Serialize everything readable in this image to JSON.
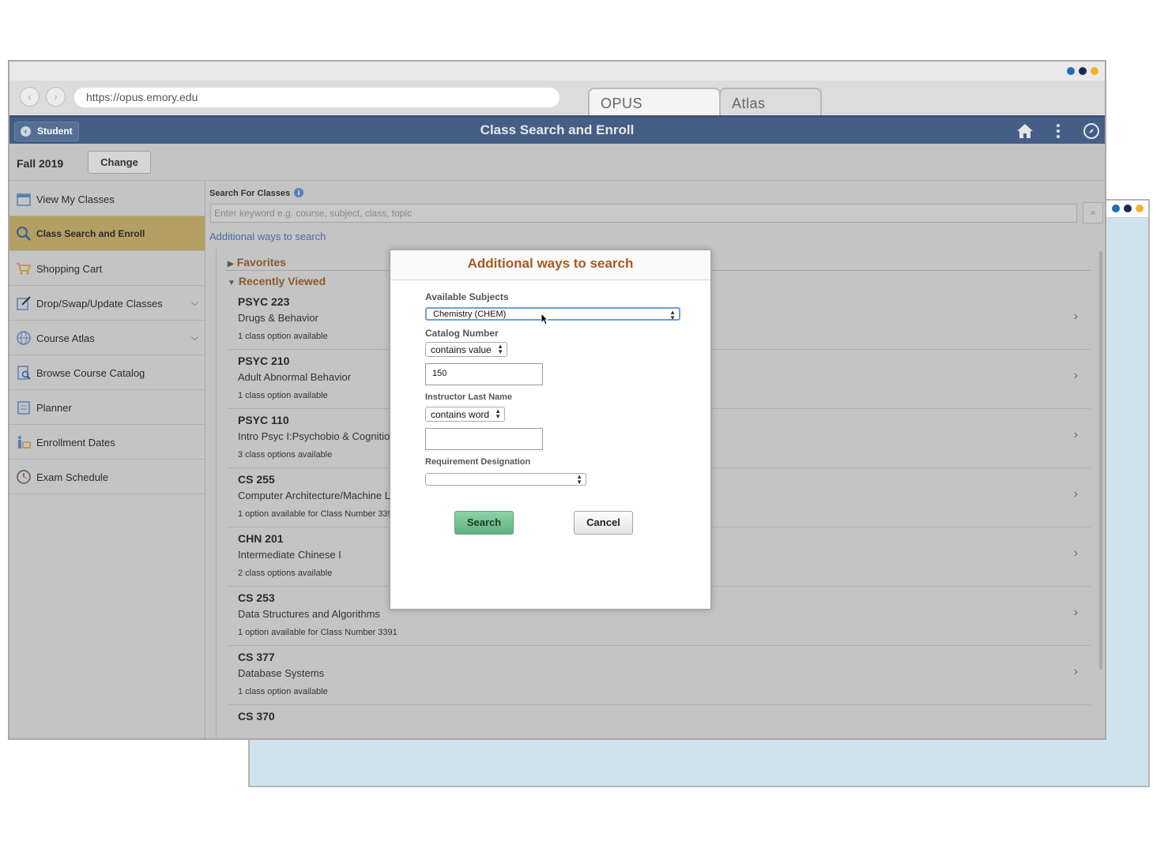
{
  "browser": {
    "url": "https://opus.emory.edu",
    "tabs": [
      "OPUS",
      "Atlas"
    ],
    "window_dot_colors": [
      "#1f6fb5",
      "#1c2a52",
      "#f2b324"
    ]
  },
  "header": {
    "back_label": "Student",
    "title": "Class Search and Enroll"
  },
  "term": {
    "label": "Fall 2019",
    "change_label": "Change"
  },
  "sidebar": {
    "items": [
      {
        "label": "View My Classes",
        "icon": "calendar-icon"
      },
      {
        "label": "Class Search and Enroll",
        "icon": "search-icon"
      },
      {
        "label": "Shopping Cart",
        "icon": "cart-icon"
      },
      {
        "label": "Drop/Swap/Update Classes",
        "icon": "edit-icon"
      },
      {
        "label": "Course Atlas",
        "icon": "globe-icon"
      },
      {
        "label": "Browse Course Catalog",
        "icon": "catalog-icon"
      },
      {
        "label": "Planner",
        "icon": "planner-icon"
      },
      {
        "label": "Enrollment Dates",
        "icon": "dates-icon"
      },
      {
        "label": "Exam Schedule",
        "icon": "clock-icon"
      }
    ]
  },
  "search": {
    "heading": "Search For Classes",
    "placeholder": "Enter keyword e.g. course, subject, class, topic",
    "go": "»",
    "additional_link": "Additional ways to search"
  },
  "sections": {
    "favorites": "Favorites",
    "recently_viewed": "Recently Viewed"
  },
  "courses": [
    {
      "code": "PSYC 223",
      "title": "Drugs & Behavior",
      "avail": "1 class option available"
    },
    {
      "code": "PSYC 210",
      "title": "Adult Abnormal Behavior",
      "avail": "1 class option available"
    },
    {
      "code": "PSYC 110",
      "title": "Intro Psyc I:Psychobio & Cognition",
      "avail": "3 class options available"
    },
    {
      "code": "CS 255",
      "title": "Computer Architecture/Machine Le",
      "avail": "1 option available for Class Number 3393"
    },
    {
      "code": "CHN 201",
      "title": "Intermediate Chinese I",
      "avail": "2 class options available"
    },
    {
      "code": "CS 253",
      "title": "Data Structures and Algorithms",
      "avail": "1 option available for Class Number 3391"
    },
    {
      "code": "CS 377",
      "title": "Database Systems",
      "avail": "1 class option available"
    },
    {
      "code": "CS 370",
      "title": "",
      "avail": ""
    }
  ],
  "modal": {
    "title": "Additional ways to search",
    "subjects_label": "Available Subjects",
    "subjects_value": "Chemistry (CHEM)",
    "catalog_label": "Catalog Number",
    "catalog_operator": "contains value",
    "catalog_value": "150",
    "instructor_label": "Instructor Last Name",
    "instructor_operator": "contains word",
    "instructor_value": "",
    "requirement_label": "Requirement Designation",
    "requirement_value": "",
    "search_label": "Search",
    "cancel_label": "Cancel"
  }
}
